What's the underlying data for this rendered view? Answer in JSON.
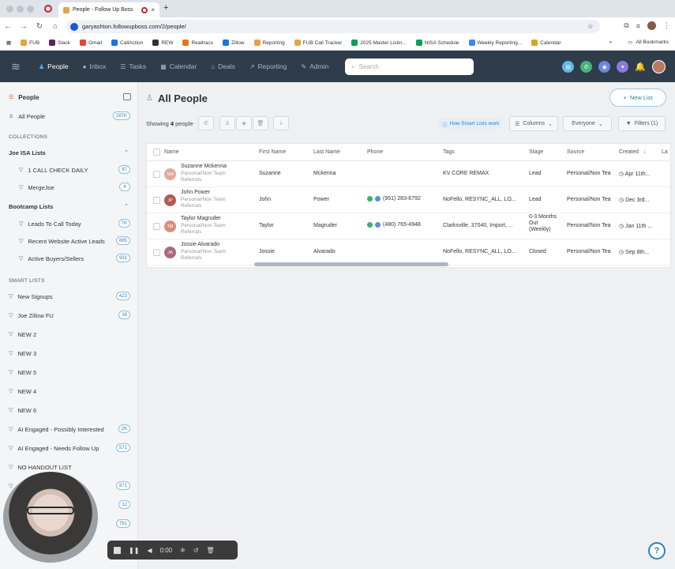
{
  "browser": {
    "tab_title": "People - Follow Up Boss",
    "new_tab": "+",
    "tab_close": "×",
    "url": "garyashton.followupboss.com/2/people/",
    "bookmarks": [
      {
        "label": "FUB",
        "color": "#e2a44a"
      },
      {
        "label": "Slack",
        "color": "#611f69"
      },
      {
        "label": "Gmail",
        "color": "#ea4335"
      },
      {
        "label": "CallAction",
        "color": "#1a73e8"
      },
      {
        "label": "REW",
        "color": "#333333"
      },
      {
        "label": "Realtracs",
        "color": "#e07a1f"
      },
      {
        "label": "Zillow",
        "color": "#1277e1"
      },
      {
        "label": "Reporting",
        "color": "#e2a44a"
      },
      {
        "label": "FUB Call Tracker",
        "color": "#e2a44a"
      },
      {
        "label": "2025 Master Listin...",
        "color": "#0f9d58"
      },
      {
        "label": "NISA Schedule",
        "color": "#0f9d58"
      },
      {
        "label": "Weekly Reporting...",
        "color": "#4285f4"
      },
      {
        "label": "Calendar",
        "color": "#d9a520"
      }
    ],
    "all_bookmarks": "All Bookmarks",
    "more": "»"
  },
  "nav": {
    "items": [
      {
        "label": "People",
        "icon": "people-icon",
        "active": true
      },
      {
        "label": "Inbox",
        "icon": "inbox-icon",
        "active": false
      },
      {
        "label": "Tasks",
        "icon": "tasks-icon",
        "active": false
      },
      {
        "label": "Calendar",
        "icon": "calendar-icon",
        "active": false
      },
      {
        "label": "Deals",
        "icon": "deals-icon",
        "active": false
      },
      {
        "label": "Reporting",
        "icon": "reporting-icon",
        "active": false
      },
      {
        "label": "Admin",
        "icon": "admin-icon",
        "active": false
      }
    ],
    "search_placeholder": "Search",
    "accent": "#4fb3e8"
  },
  "sidebar": {
    "title": "People",
    "all_people": {
      "label": "All People",
      "count": "287K"
    },
    "collections_heading": "COLLECTIONS",
    "groups": [
      {
        "label": "Joe ISA Lists",
        "items": [
          {
            "label": "1 CALL CHECK DAILY",
            "count": "87"
          },
          {
            "label": "MergeJoe",
            "count": "4"
          }
        ]
      },
      {
        "label": "Bootcamp Lists",
        "items": [
          {
            "label": "Leads To Call Today",
            "count": "7K"
          },
          {
            "label": "Recent Website Active Leads",
            "count": "885"
          },
          {
            "label": "Active Buyers/Sellers",
            "count": "931"
          }
        ]
      }
    ],
    "smart_heading": "SMART LISTS",
    "smart_lists": [
      {
        "label": "New Signups",
        "count": "423"
      },
      {
        "label": "Joe Zillow FU",
        "count": "38"
      },
      {
        "label": "NEW 2",
        "count": ""
      },
      {
        "label": "NEW 3",
        "count": ""
      },
      {
        "label": "NEW 5",
        "count": ""
      },
      {
        "label": "NEW 4",
        "count": ""
      },
      {
        "label": "NEW 6",
        "count": ""
      },
      {
        "label": "AI Engaged - Possibly Interested",
        "count": "2K"
      },
      {
        "label": "AI Engaged - Needs Follow Up",
        "count": "571"
      },
      {
        "label": "NO HANDOUT LIST",
        "count": ""
      },
      {
        "label": "",
        "count": "871"
      },
      {
        "label": "",
        "count": "12"
      },
      {
        "label": "",
        "count": "761"
      }
    ]
  },
  "main": {
    "title": "All People",
    "new_list": "New List",
    "showing_prefix": "Showing ",
    "showing_count": "4",
    "showing_suffix": " people",
    "smart_link": "How Smart Lists work",
    "columns_btn": "Columns",
    "everyone_btn": "Everyone",
    "filters_btn": "Filters (1)",
    "columns": [
      "Name",
      "First Name",
      "Last Name",
      "Phone",
      "Tags",
      "Stage",
      "Source",
      "Created",
      "La"
    ],
    "rows": [
      {
        "initials": "SM",
        "avatar_color": "#e3a99b",
        "name": "Suzanne Mckenna",
        "source_sub": "Personal/Non Team Referrals",
        "first": "Suzanne",
        "last": "Mckenna",
        "phone": "",
        "tags": "KV CORE REMAX",
        "stage": "Lead",
        "source": "Personal/Non Tea",
        "created": "Apr 11th..."
      },
      {
        "initials": "JP",
        "avatar_color": "#b35a55",
        "name": "John Power",
        "source_sub": "Personal/Non Team Referrals",
        "first": "John",
        "last": "Power",
        "phone": "(951) 283-6792",
        "tags": "NoFello, RESYNC_ALL, LO...",
        "stage": "Lead",
        "source": "Personal/Non Tea",
        "created": "Dec 3rd..."
      },
      {
        "initials": "TM",
        "avatar_color": "#d98f7f",
        "name": "Taylor Magruder",
        "source_sub": "Personal/Non Team Referrals",
        "first": "Taylor",
        "last": "Magruder",
        "phone": "(480) 765-4948",
        "tags": "Clarksville, 37040, Import, ...",
        "stage": "0-3 Months Out (Weekly)",
        "source": "Personal/Non Tea",
        "created": "Jan 11th ..."
      },
      {
        "initials": "JA",
        "avatar_color": "#a86a7a",
        "name": "Jossie Alvarado",
        "source_sub": "Personal/Non Team Referrals",
        "first": "Jossie",
        "last": "Alvarado",
        "phone": "",
        "tags": "NoFello, RESYNC_ALL, LO...",
        "stage": "Closed",
        "source": "Personal/Non Tea",
        "created": "Sep 8th..."
      }
    ]
  },
  "recorder": {
    "time": "0:00"
  },
  "help": "?"
}
